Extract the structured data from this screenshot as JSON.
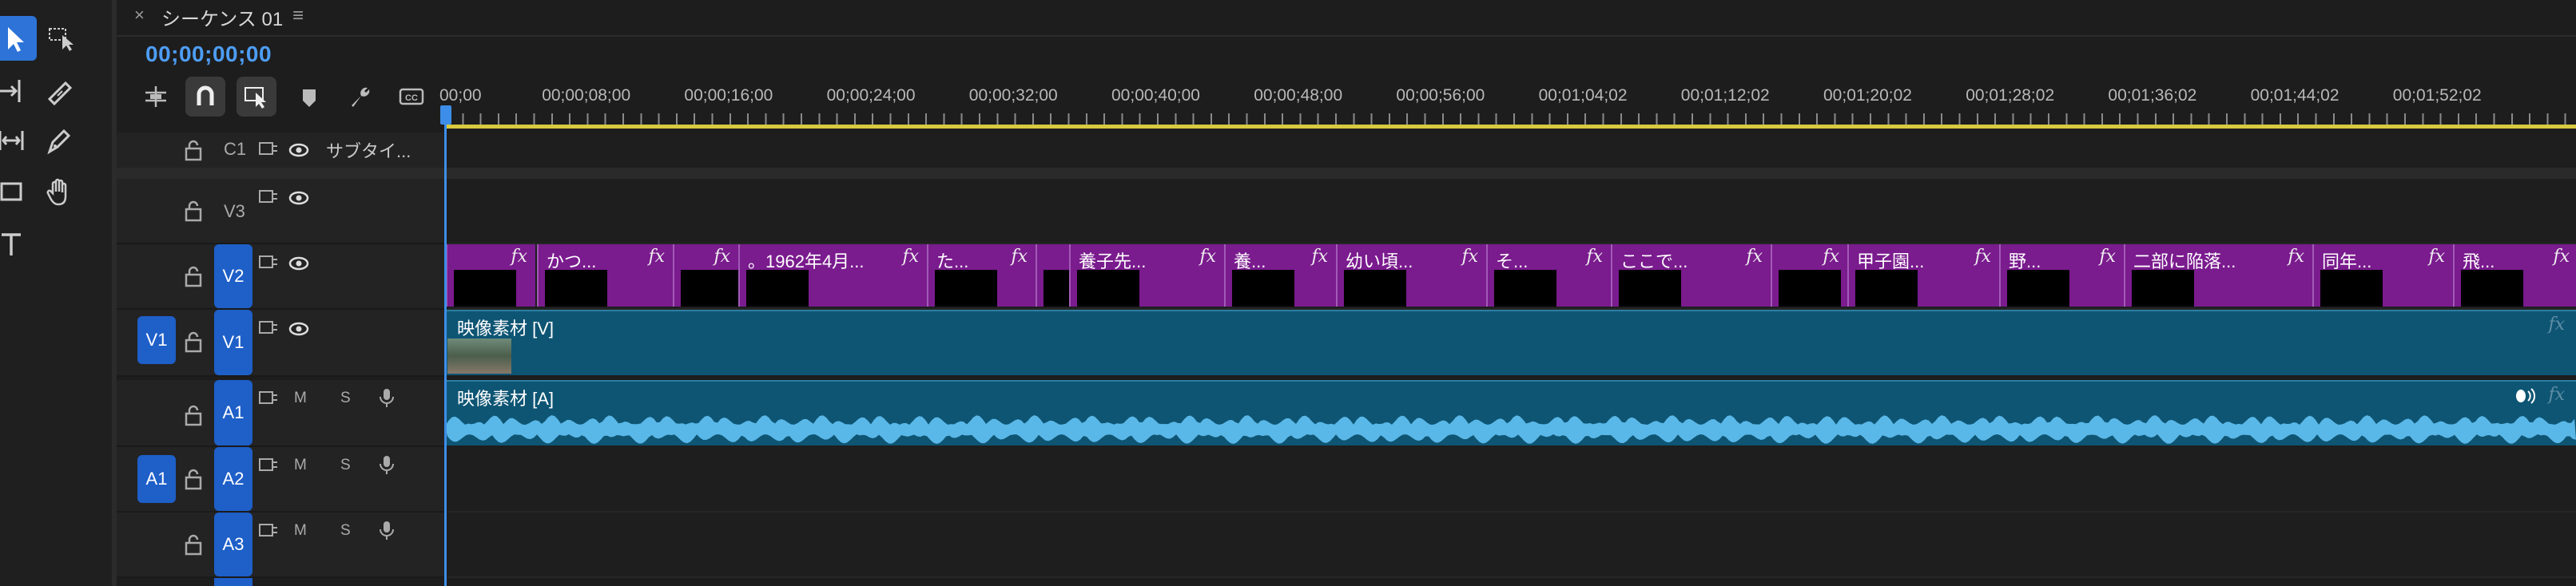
{
  "header": {
    "close": "×",
    "title": "シーケンス 01",
    "menu": "≡",
    "timecode": "00;00;00;00"
  },
  "ruler": [
    "00;00",
    "00;00;08;00",
    "00;00;16;00",
    "00;00;24;00",
    "00;00;32;00",
    "00;00;40;00",
    "00;00;48;00",
    "00;00;56;00",
    "00;01;04;02",
    "00;01;12;02",
    "00;01;20;02",
    "00;01;28;02",
    "00;01;36;02",
    "00;01;44;02",
    "00;01;52;02"
  ],
  "tracks": {
    "c1": {
      "name": "C1",
      "label": "サブタイ..."
    },
    "v3": {
      "name": "V3"
    },
    "v2": {
      "name": "V2"
    },
    "v1": {
      "name": "V1",
      "source": "V1"
    },
    "a1": {
      "name": "A1",
      "m": "M",
      "s": "S",
      "source": "A1"
    },
    "a2": {
      "name": "A2",
      "m": "M",
      "s": "S"
    },
    "a3": {
      "name": "A3",
      "m": "M",
      "s": "S"
    }
  },
  "v2_clips": [
    {
      "label": "",
      "fx": "fx"
    },
    {
      "label": "かつ...",
      "fx": "fx"
    },
    {
      "label": "",
      "fx": "fx"
    },
    {
      "label": "。1962年4月...",
      "fx": "fx"
    },
    {
      "label": "た...",
      "fx": "fx"
    },
    {
      "label": "",
      "fx": ""
    },
    {
      "label": "養子先...",
      "fx": "fx"
    },
    {
      "label": "養...",
      "fx": "fx"
    },
    {
      "label": "幼い頃...",
      "fx": "fx"
    },
    {
      "label": "そ...",
      "fx": "fx"
    },
    {
      "label": "ここで...",
      "fx": "fx"
    },
    {
      "label": "",
      "fx": "fx"
    },
    {
      "label": "甲子園...",
      "fx": "fx"
    },
    {
      "label": "野...",
      "fx": "fx"
    },
    {
      "label": "二部に陥落...",
      "fx": "fx"
    },
    {
      "label": "同年...",
      "fx": "fx"
    },
    {
      "label": "飛...",
      "fx": "fx"
    }
  ],
  "v1_clip": {
    "label": "映像素材 [V]",
    "fx": "fx"
  },
  "a1_clip": {
    "label": "映像素材 [A]",
    "fx": "fx"
  },
  "colors": {
    "accent": "#2d73d8",
    "timecode": "#4d9df5",
    "v2clip": "#7a1b8e",
    "v1clip": "#0e5574",
    "waveform": "#5ab8e8",
    "workarea": "#d9c93e"
  }
}
